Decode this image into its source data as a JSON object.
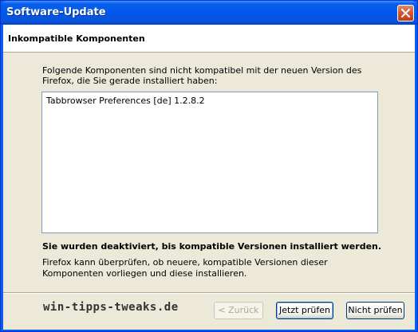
{
  "window": {
    "title": "Software-Update"
  },
  "header": {
    "title": "Inkompatible Komponenten"
  },
  "content": {
    "intro": "Folgende Komponenten sind nicht kompatibel mit der neuen Version des Firefox, die Sie gerade installiert haben:",
    "items": [
      {
        "label": "Tabbrowser Preferences [de] 1.2.8.2"
      }
    ],
    "warning": "Sie wurden deaktiviert, bis kompatible Versionen installiert werden.",
    "info": "Firefox kann überprüfen, ob neuere, kompatible Versionen dieser Komponenten vorliegen und diese installieren."
  },
  "footer": {
    "watermark": "win-tipps-tweaks.de",
    "back_label": "< Zurück",
    "check_label": "Jetzt prüfen",
    "nocheck_label": "Nicht prüfen"
  },
  "icons": {
    "close": "close-icon"
  },
  "colors": {
    "titlebar": "#0058ee",
    "close_button": "#d35a37",
    "dialog_background": "#ece9d8",
    "listbox_border": "#7f9db9"
  }
}
